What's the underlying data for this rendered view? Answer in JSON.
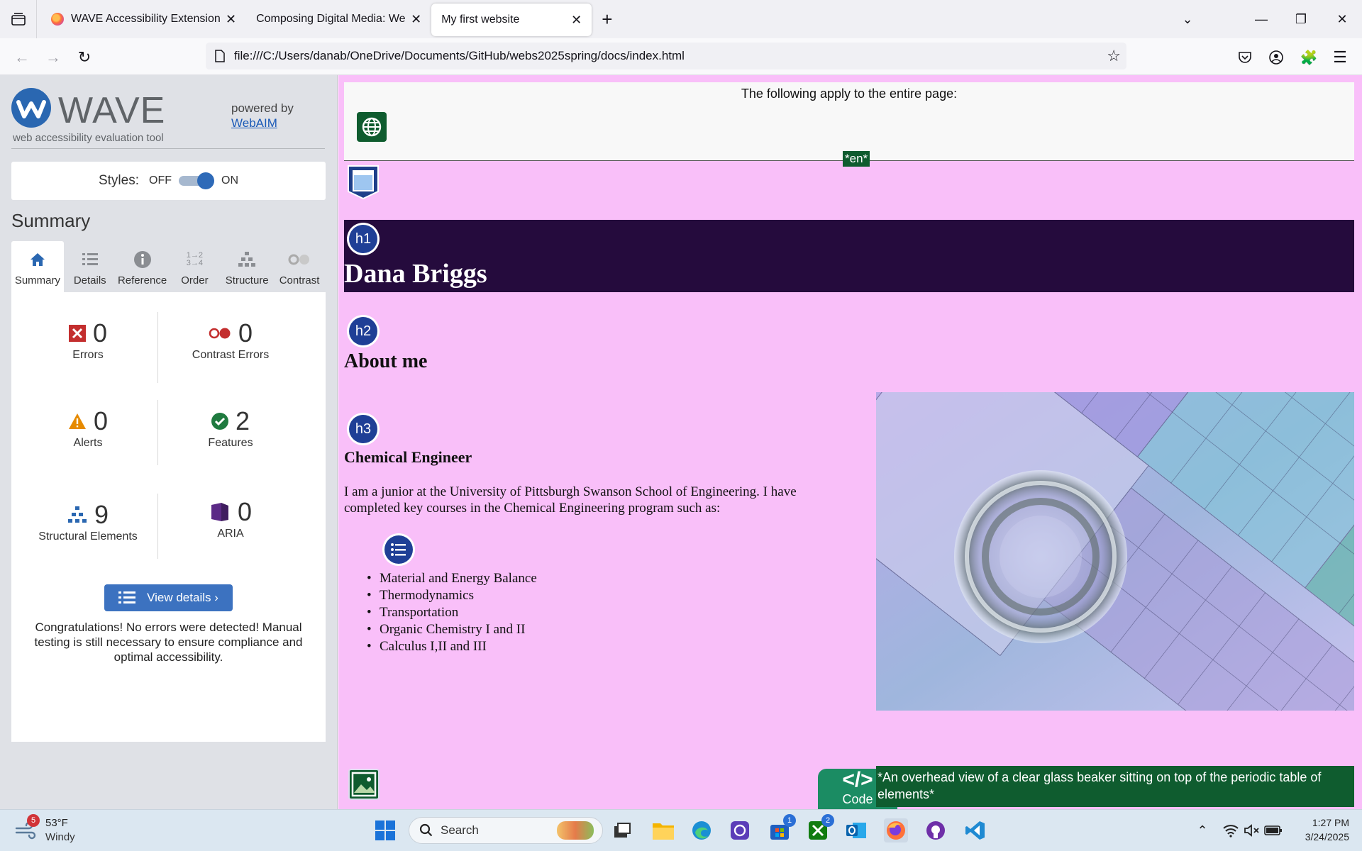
{
  "browser": {
    "tabs": [
      {
        "title": "WAVE Accessibility Extension – (",
        "active": false
      },
      {
        "title": "Composing Digital Media: Web Unit",
        "active": false
      },
      {
        "title": "My first website",
        "active": true
      }
    ],
    "url": "file:///C:/Users/danab/OneDrive/Documents/GitHub/webs2025spring/docs/index.html"
  },
  "wave": {
    "title": "WAVE",
    "subtitle": "web accessibility evaluation tool",
    "powered_by": "powered by",
    "webaim": "WebAIM",
    "styles_label": "Styles:",
    "off": "OFF",
    "on": "ON",
    "summary_heading": "Summary",
    "tabs": [
      {
        "label": "Summary",
        "icon": "home-icon",
        "active": true
      },
      {
        "label": "Details",
        "icon": "list-icon",
        "active": false
      },
      {
        "label": "Reference",
        "icon": "info-icon",
        "active": false
      },
      {
        "label": "Order",
        "icon": "order-icon",
        "active": false
      },
      {
        "label": "Structure",
        "icon": "structure-icon",
        "active": false
      },
      {
        "label": "Contrast",
        "icon": "contrast-icon",
        "active": false
      }
    ],
    "stats": {
      "errors": {
        "count": "0",
        "label": "Errors"
      },
      "contrast": {
        "count": "0",
        "label": "Contrast Errors"
      },
      "alerts": {
        "count": "0",
        "label": "Alerts"
      },
      "features": {
        "count": "2",
        "label": "Features"
      },
      "structure": {
        "count": "9",
        "label": "Structural Elements"
      },
      "aria": {
        "count": "0",
        "label": "ARIA"
      }
    },
    "view_details": "View details ›",
    "congrats": "Congratulations! No errors were detected! Manual testing is still necessary to ensure compliance and optimal accessibility."
  },
  "page": {
    "lang_message": "The following apply to the entire page:",
    "lang_tag": "*en*",
    "h1_badge": "h1",
    "h2_badge": "h2",
    "h3_badge": "h3",
    "h1": "Dana Briggs",
    "h2": "About me",
    "h3": "Chemical Engineer",
    "paragraph": "I am a junior at the University of Pittsburgh Swanson School of Engineering. I have completed key courses in the Chemical Engineering program such as:",
    "courses": [
      "Material and Energy Balance",
      "Thermodynamics",
      "Transportation",
      "Organic Chemistry I and II",
      "Calculus I,II and III"
    ],
    "alt_text": "*An overhead view of a clear glass beaker sitting on top of the periodic table of elements*",
    "code_tab": "Code"
  },
  "taskbar": {
    "temp": "53°F",
    "condition": "Windy",
    "weather_badge": "5",
    "search": "Search",
    "time": "1:27 PM",
    "date": "3/24/2025",
    "store_badge": "1",
    "xbox_badge": "2"
  },
  "colors": {
    "page_bg": "#f9bff9",
    "banner_bg": "#250b3d",
    "wave_blue": "#2a67b1",
    "feature_green": "#0f5c2f"
  }
}
